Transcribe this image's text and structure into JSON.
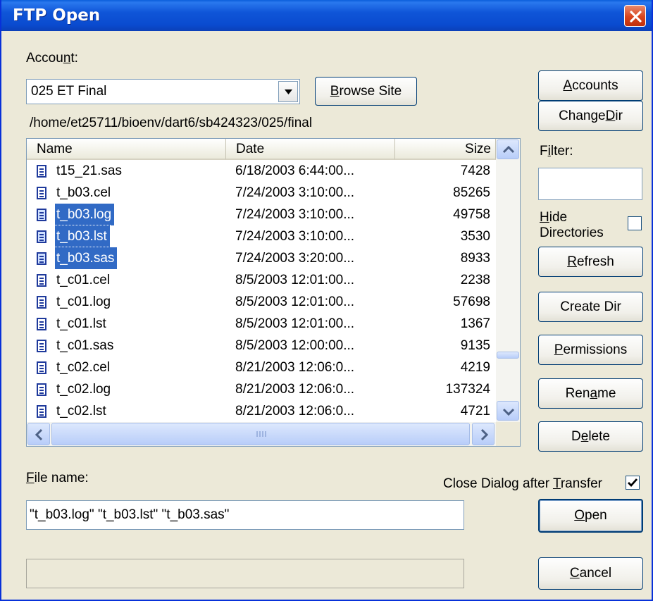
{
  "window": {
    "title": "FTP Open"
  },
  "account": {
    "label_pre": "Accou",
    "label_key": "n",
    "label_post": "t:",
    "selected": "025 ET Final",
    "browse_pre": "",
    "browse_key": "B",
    "browse_post": "rowse Site"
  },
  "path": "/home/et25711/bioenv/dart6/sb424323/025/final",
  "columns": {
    "name": "Name",
    "date": "Date",
    "size": "Size"
  },
  "files": [
    {
      "name": "t15_21.sas",
      "date": "6/18/2003  6:44:00...",
      "size": "7428",
      "selected": false
    },
    {
      "name": "t_b03.cel",
      "date": "7/24/2003  3:10:00...",
      "size": "85265",
      "selected": false
    },
    {
      "name": "t_b03.log",
      "date": "7/24/2003  3:10:00...",
      "size": "49758",
      "selected": true
    },
    {
      "name": "t_b03.lst",
      "date": "7/24/2003  3:10:00...",
      "size": "3530",
      "selected": true
    },
    {
      "name": "t_b03.sas",
      "date": "7/24/2003  3:20:00...",
      "size": "8933",
      "selected": true
    },
    {
      "name": "t_c01.cel",
      "date": "8/5/2003  12:01:00...",
      "size": "2238",
      "selected": false
    },
    {
      "name": "t_c01.log",
      "date": "8/5/2003  12:01:00...",
      "size": "57698",
      "selected": false
    },
    {
      "name": "t_c01.lst",
      "date": "8/5/2003  12:01:00...",
      "size": "1367",
      "selected": false
    },
    {
      "name": "t_c01.sas",
      "date": "8/5/2003  12:00:00...",
      "size": "9135",
      "selected": false
    },
    {
      "name": "t_c02.cel",
      "date": "8/21/2003  12:06:0...",
      "size": "4219",
      "selected": false
    },
    {
      "name": "t_c02.log",
      "date": "8/21/2003  12:06:0...",
      "size": "137324",
      "selected": false
    },
    {
      "name": "t_c02.lst",
      "date": "8/21/2003  12:06:0...",
      "size": "4721",
      "selected": false
    }
  ],
  "buttons": {
    "accounts_pre": "",
    "accounts_key": "A",
    "accounts_post": "ccounts",
    "change_dir_pre": "Change ",
    "change_dir_key": "D",
    "change_dir_post": "ir",
    "refresh_pre": "",
    "refresh_key": "R",
    "refresh_post": "efresh",
    "create_dir": "Create Dir",
    "permissions_pre": "",
    "permissions_key": "P",
    "permissions_post": "ermissions",
    "rename_pre": "Ren",
    "rename_key": "a",
    "rename_post": "me",
    "delete_pre": "D",
    "delete_key": "e",
    "delete_post": "lete",
    "open_pre": "",
    "open_key": "O",
    "open_post": "pen",
    "cancel_pre": "",
    "cancel_key": "C",
    "cancel_post": "ancel"
  },
  "filter": {
    "label_pre": "F",
    "label_key": "i",
    "label_post": "lter:",
    "value": ""
  },
  "hide_dirs": {
    "line1_key": "H",
    "line1_post": "ide",
    "line2": "Directories",
    "checked": false
  },
  "file_name": {
    "label_key": "F",
    "label_post": "ile name:",
    "value": "\"t_b03.log\" \"t_b03.lst\" \"t_b03.sas\""
  },
  "close_after": {
    "label_pre": "Close Dialog after ",
    "label_key": "T",
    "label_post": "ransfer",
    "checked": true
  },
  "status": ""
}
